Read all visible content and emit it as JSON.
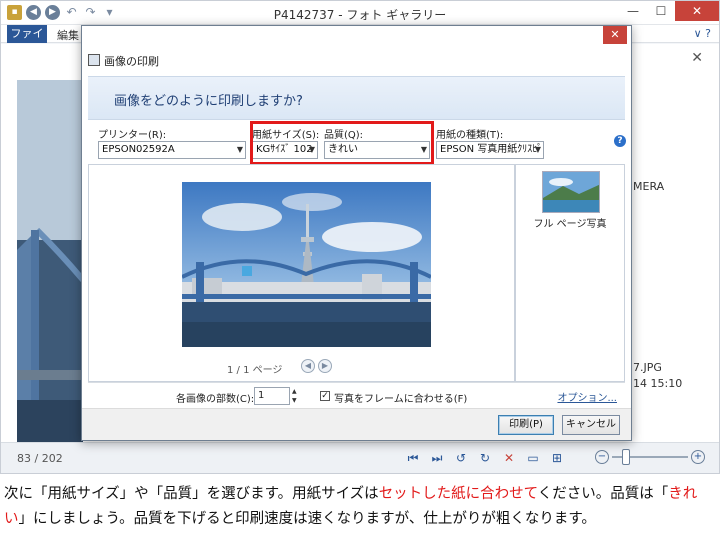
{
  "window": {
    "title": "P4142737 - フォト ギャラリー",
    "close_glyph": "✕",
    "minimize_glyph": "—",
    "maximize_glyph": "☐"
  },
  "ribbon": {
    "file_tab": "ファイル",
    "edit_tab": "編集",
    "right_glyphs": "∨ ?"
  },
  "gallery": {
    "partial_text_1": "MERA",
    "partial_text_2": "7.JPG",
    "partial_text_3": "14 15:10",
    "close_glyph": "✕"
  },
  "status": {
    "counter": "83 / 202"
  },
  "dialog": {
    "title": "画像の印刷",
    "close_glyph": "✕",
    "question": "画像をどのように印刷しますか?",
    "printer_label": "プリンター(R):",
    "printer_value": "EPSON02592A",
    "paper_size_label": "用紙サイズ(S):",
    "paper_size_value": "KGｻｲｽﾞ 102",
    "quality_label": "品質(Q):",
    "quality_value": "きれい",
    "paper_type_label": "用紙の種類(T):",
    "paper_type_value": "EPSON 写真用紙ｸﾘｽﾋﾟ",
    "help_glyph": "?",
    "page_indicator": "1 / 1 ページ",
    "thumb_label": "フル ページ写真",
    "copies_label": "各画像の部数(C):",
    "copies_value": "1",
    "fit_label": "写真をフレームに合わせる(F)",
    "options_link": "オプション...",
    "print_button": "印刷(P)",
    "cancel_button": "キャンセル"
  },
  "caption": {
    "p1": "次に「用紙サイズ」や「品質」を選びます。用紙サイズは",
    "h1": "セットした紙に合わせて",
    "p2": "ください。品質は「",
    "h2": "きれい",
    "p3": "」にしましょう。品質を下げると印刷速度は速くなりますが、仕上がりが粗くなります。"
  },
  "colors": {
    "accent": "#2b5797",
    "highlight": "#e21a1a",
    "close": "#c7433a"
  }
}
